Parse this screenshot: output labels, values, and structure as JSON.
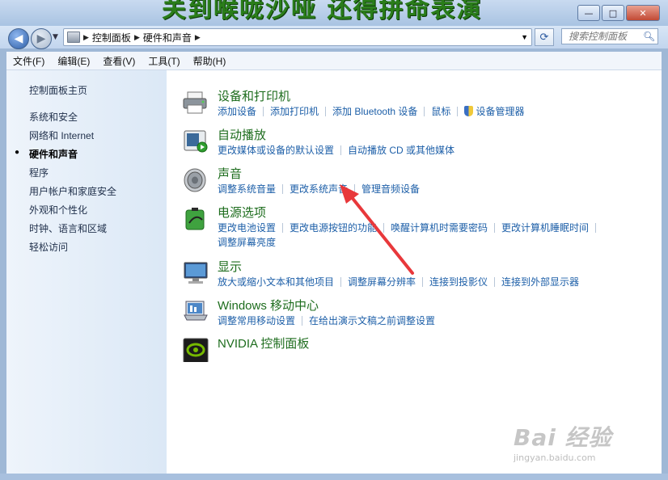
{
  "banner_text": "关到喉咙沙哑 还得拼命表演",
  "window_buttons": {
    "minimize": "—",
    "maximize": "□",
    "close": "✕"
  },
  "nav": {
    "back": "◀",
    "forward": "▶",
    "dropdown": "▼"
  },
  "address": {
    "icon": "control-panel-icon",
    "segments": [
      "控制面板",
      "硬件和声音"
    ],
    "separator": "▶",
    "dropdown": "▼",
    "refresh": "⟳"
  },
  "search": {
    "placeholder": "搜索控制面板",
    "icon": "🔍"
  },
  "menu": [
    "文件(F)",
    "编辑(E)",
    "查看(V)",
    "工具(T)",
    "帮助(H)"
  ],
  "left_pane": {
    "home": "控制面板主页",
    "items": [
      "系统和安全",
      "网络和 Internet",
      "硬件和声音",
      "程序",
      "用户帐户和家庭安全",
      "外观和个性化",
      "时钟、语言和区域",
      "轻松访问"
    ],
    "current_index": 2,
    "bullet": "●"
  },
  "categories": [
    {
      "title": "设备和打印机",
      "icon": "printer-icon",
      "links": [
        "添加设备",
        "添加打印机",
        "添加 Bluetooth 设备",
        "鼠标",
        "设备管理器"
      ]
    },
    {
      "title": "自动播放",
      "icon": "autoplay-icon",
      "links": [
        "更改媒体或设备的默认设置",
        "自动播放 CD 或其他媒体"
      ]
    },
    {
      "title": "声音",
      "icon": "speaker-icon",
      "links": [
        "调整系统音量",
        "更改系统声音",
        "管理音频设备"
      ]
    },
    {
      "title": "电源选项",
      "icon": "battery-icon",
      "links": [
        "更改电池设置",
        "更改电源按钮的功能",
        "唤醒计算机时需要密码",
        "更改计算机睡眠时间"
      ],
      "links2": [
        "调整屏幕亮度"
      ]
    },
    {
      "title": "显示",
      "icon": "monitor-icon",
      "links": [
        "放大或缩小文本和其他项目",
        "调整屏幕分辨率",
        "连接到投影仪",
        "连接到外部显示器"
      ]
    },
    {
      "title": "Windows 移动中心",
      "icon": "mobility-center-icon",
      "links": [
        "调整常用移动设置",
        "在给出演示文稿之前调整设置"
      ]
    },
    {
      "title": "NVIDIA 控制面板",
      "icon": "nvidia-icon",
      "links": []
    }
  ],
  "watermark": {
    "main": "Bai 经验",
    "sub": "jingyan.baidu.com"
  }
}
